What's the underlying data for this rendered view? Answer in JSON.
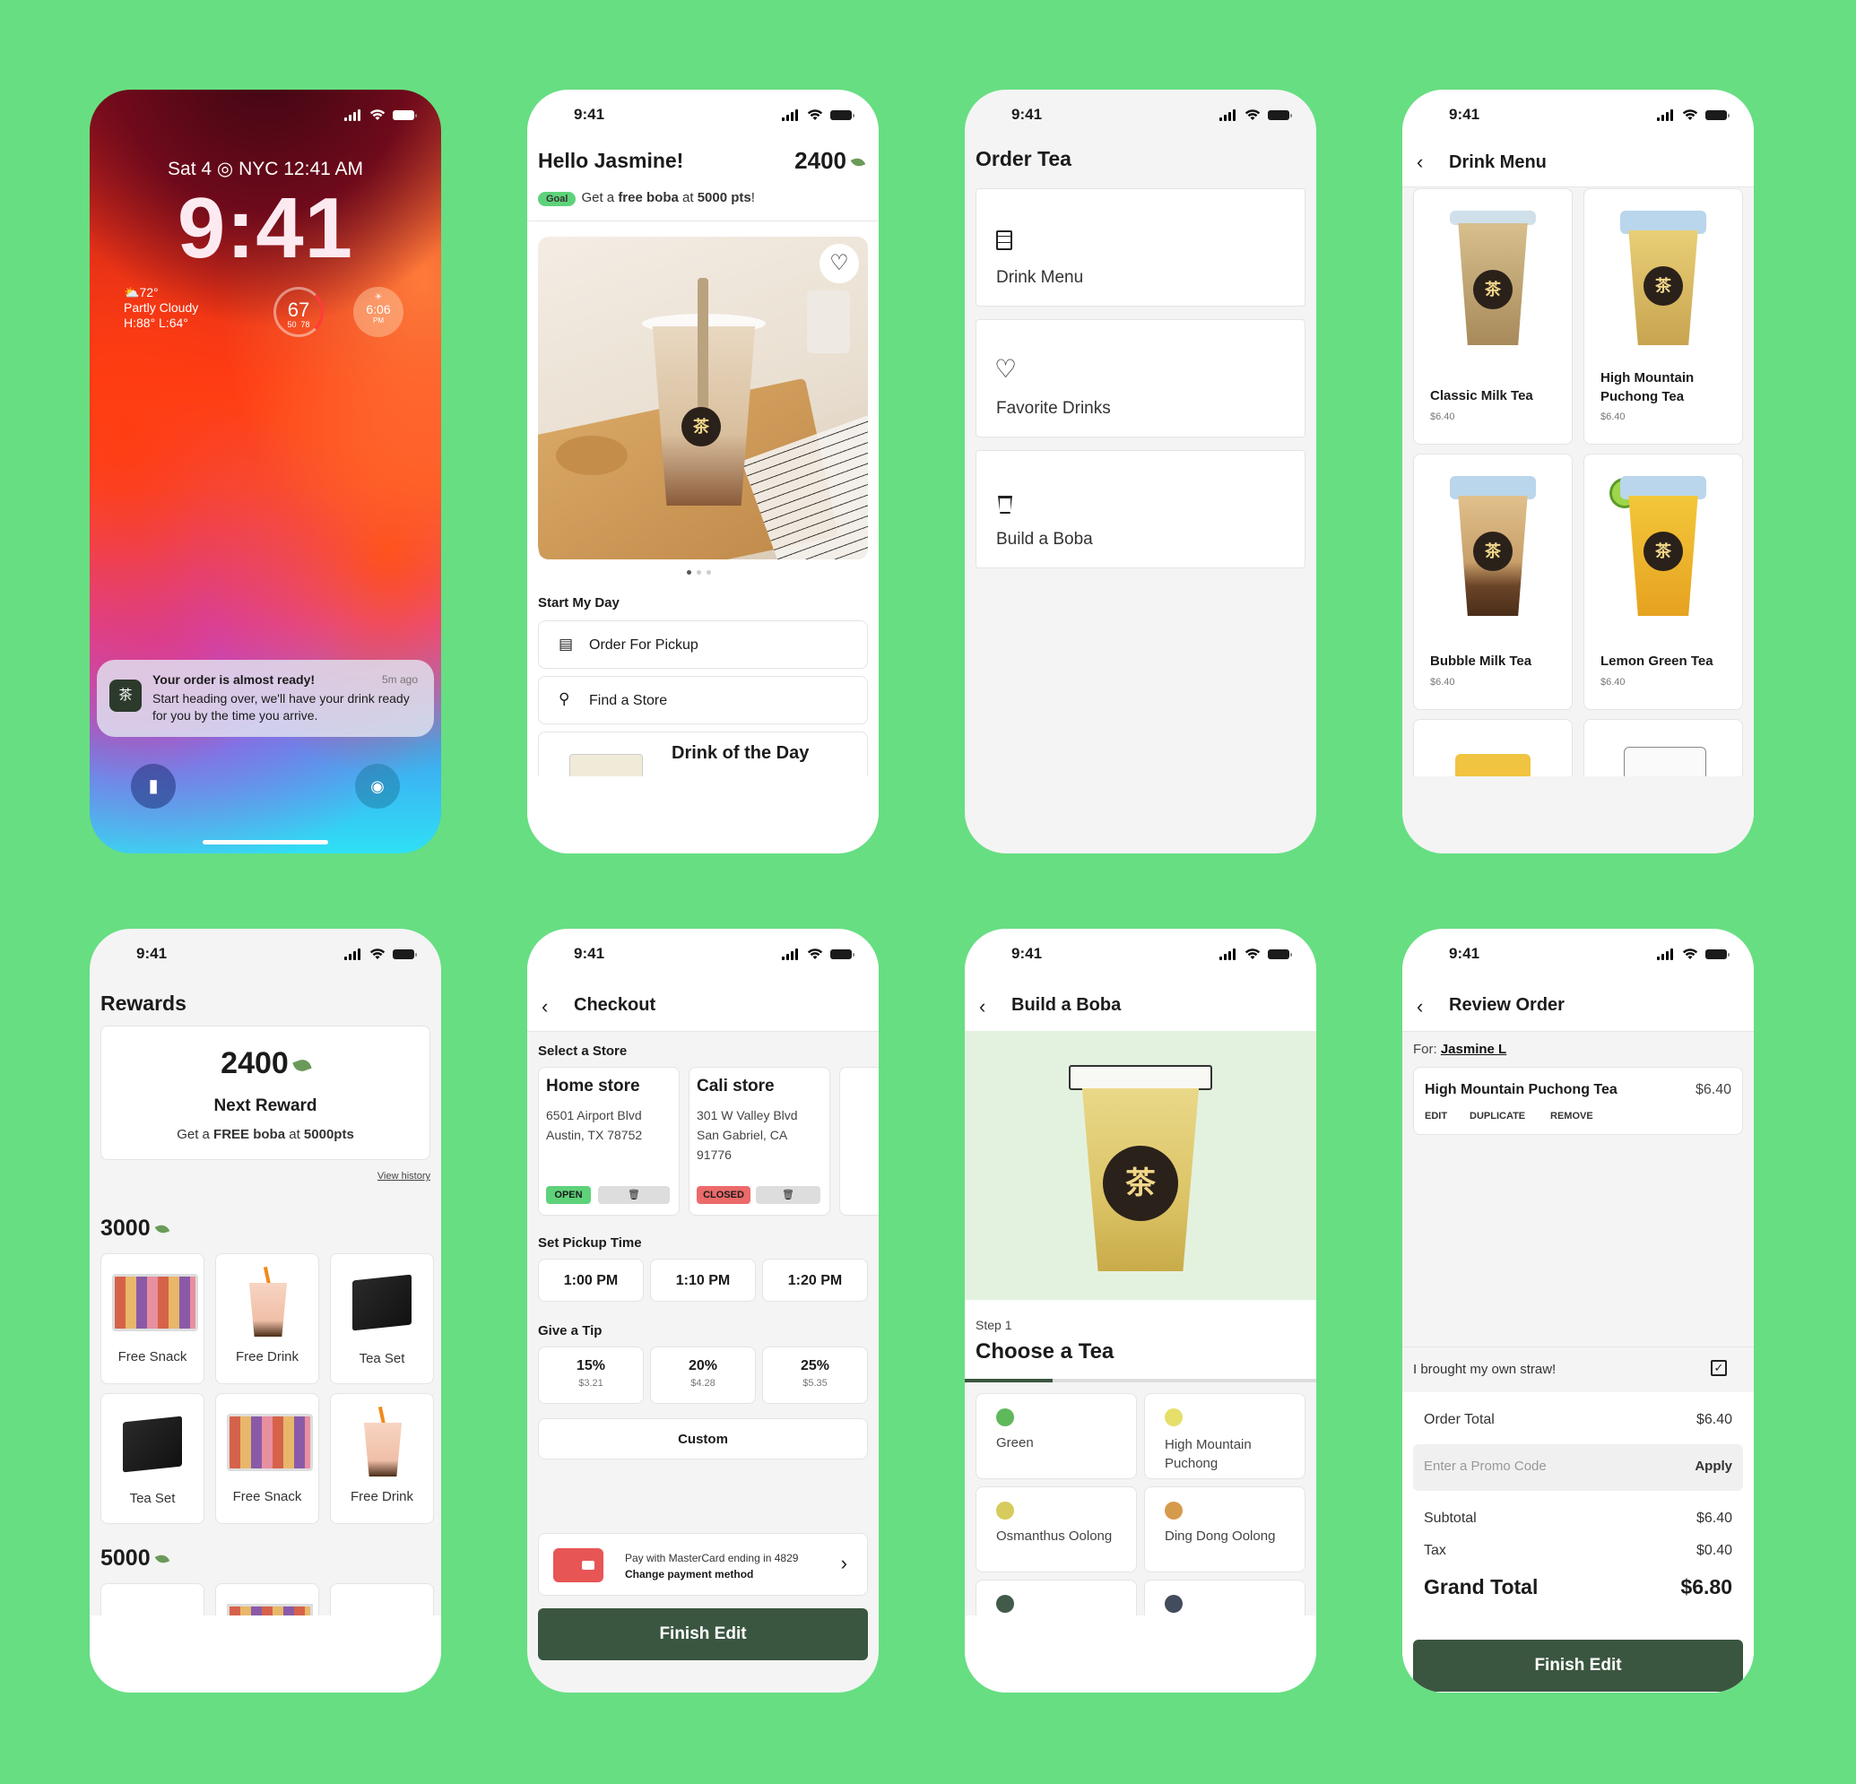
{
  "status_time": "9:41",
  "colors": {
    "background": "#67de82",
    "primary": "#3b5640",
    "accent_green": "#5ed27a",
    "closed_red": "#ec6a6a"
  },
  "lock": {
    "date": "Sat 4",
    "city": "NYC 12:41 AM",
    "time": "9:41",
    "weather_temp": "72°",
    "weather_desc": "Partly Cloudy",
    "weather_hl": "H:88° L:64°",
    "gauge_value": "67",
    "gauge_min": "50",
    "gauge_max": "78",
    "sun_time": "6:06",
    "sun_pm": "PM",
    "notif_title": "Your order is almost ready!",
    "notif_ago": "5m ago",
    "notif_body": "Start heading over, we'll have your drink ready for you by the time you arrive."
  },
  "home": {
    "greeting": "Hello Jasmine!",
    "points": "2400",
    "goal_badge": "Goal",
    "goal_prefix": "Get a",
    "goal_bold": "free boba",
    "goal_mid": "at",
    "goal_pts": "5000 pts",
    "goal_suffix": "!",
    "section": "Start My Day",
    "pickup": "Order For Pickup",
    "find": "Find a Store",
    "dotd": "Drink of the Day"
  },
  "order": {
    "title": "Order Tea",
    "items": [
      "Drink Menu",
      "Favorite Drinks",
      "Build a Boba"
    ]
  },
  "menu": {
    "title": "Drink Menu",
    "items": [
      {
        "name": "Classic Milk Tea",
        "price": "$6.40"
      },
      {
        "name": "High Mountain Puchong Tea",
        "price": "$6.40"
      },
      {
        "name": "Bubble Milk Tea",
        "price": "$6.40"
      },
      {
        "name": "Lemon Green Tea",
        "price": "$6.40"
      }
    ]
  },
  "rewards": {
    "title": "Rewards",
    "points": "2400",
    "next": "Next Reward",
    "goal_prefix": "Get a",
    "goal_bold": "FREE boba",
    "goal_mid": "at",
    "goal_pts": "5000pts",
    "history": "View history",
    "tier1": "3000",
    "tier2": "5000",
    "items": [
      "Free Snack",
      "Free Drink",
      "Tea Set",
      "Tea Set",
      "Free Snack",
      "Free Drink"
    ]
  },
  "checkout": {
    "title": "Checkout",
    "select_store": "Select a Store",
    "stores": [
      {
        "name": "Home store",
        "addr": "6501 Airport Blvd Austin, TX 78752",
        "status": "OPEN"
      },
      {
        "name": "Cali store",
        "addr": "301 W Valley Blvd San Gabriel, CA 91776",
        "status": "CLOSED"
      }
    ],
    "pickup_label": "Set Pickup Time",
    "times": [
      "1:00 PM",
      "1:10 PM",
      "1:20 PM"
    ],
    "tip_label": "Give a Tip",
    "tips": [
      {
        "pct": "15%",
        "amt": "$3.21"
      },
      {
        "pct": "20%",
        "amt": "$4.28"
      },
      {
        "pct": "25%",
        "amt": "$5.35"
      }
    ],
    "custom": "Custom",
    "pay_line": "Pay with MasterCard ending in 4829",
    "pay_change": "Change payment method",
    "finish": "Finish Edit"
  },
  "build": {
    "title": "Build a Boba",
    "step": "Step 1",
    "heading": "Choose a Tea",
    "options": [
      {
        "name": "Green",
        "color": "#5fb85a"
      },
      {
        "name": "High Mountain Puchong",
        "color": "#e6df6a"
      },
      {
        "name": "Osmanthus Oolong",
        "color": "#d6cb5c"
      },
      {
        "name": "Ding Dong Oolong",
        "color": "#d69a4d"
      },
      {
        "name": "",
        "color": "#415a4a"
      },
      {
        "name": "",
        "color": "#434c5c"
      }
    ]
  },
  "review": {
    "title": "Review Order",
    "for_label": "For:",
    "for_name": "Jasmine L",
    "item": "High Mountain Puchong Tea",
    "item_price": "$6.40",
    "edit": "EDIT",
    "duplicate": "DUPLICATE",
    "remove": "REMOVE",
    "straw": "I brought my own straw!",
    "order_total_label": "Order Total",
    "order_total": "$6.40",
    "promo_placeholder": "Enter a Promo Code",
    "apply": "Apply",
    "subtotal_label": "Subtotal",
    "subtotal": "$6.40",
    "tax_label": "Tax",
    "tax": "$0.40",
    "grand_label": "Grand Total",
    "grand": "$6.80",
    "finish": "Finish Edit"
  }
}
